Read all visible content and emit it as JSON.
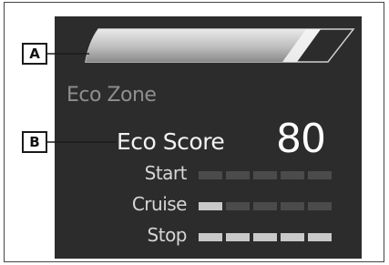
{
  "callouts": {
    "a": "A",
    "b": "B"
  },
  "screen": {
    "zone_label": "Eco Zone",
    "score_label": "Eco Score",
    "score_value": "80",
    "gauge": {
      "level": 0.9
    },
    "rows": [
      {
        "label": "Start",
        "filled": 0,
        "total": 5
      },
      {
        "label": "Cruise",
        "filled": 1,
        "total": 5
      },
      {
        "label": "Stop",
        "filled": 5,
        "total": 5
      }
    ]
  },
  "colors": {
    "screen_bg": "#2c2c2c",
    "segment_on": "#c9c9c9",
    "segment_off": "#4b4b4b",
    "text_primary": "#f2f2f2",
    "text_dim": "#8f8f8f"
  }
}
